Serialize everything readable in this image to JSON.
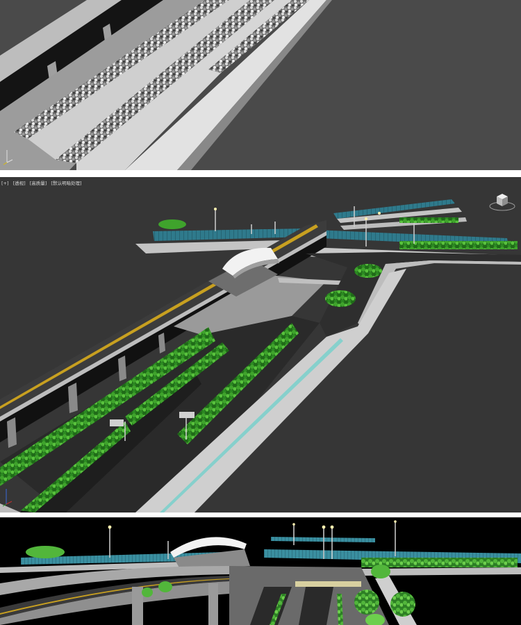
{
  "viewport": {
    "menu_plus": "[+]",
    "menu_view": "[透视]",
    "menu_shading": "[高质量]",
    "menu_lighting": "[默认明暗处理]"
  },
  "colors": {
    "panel1_bg": "#4a4a4a",
    "panel2_bg": "#363636",
    "panel3_bg": "#000000",
    "foliage_green": "#3fa32c",
    "solar_blue": "#2f7a8c",
    "road_dark": "#2a2a2a",
    "median_line": "#c8a020"
  },
  "icons": {
    "axis_gizmo": "axis-gizmo-icon",
    "view_cube": "view-cube-icon"
  }
}
